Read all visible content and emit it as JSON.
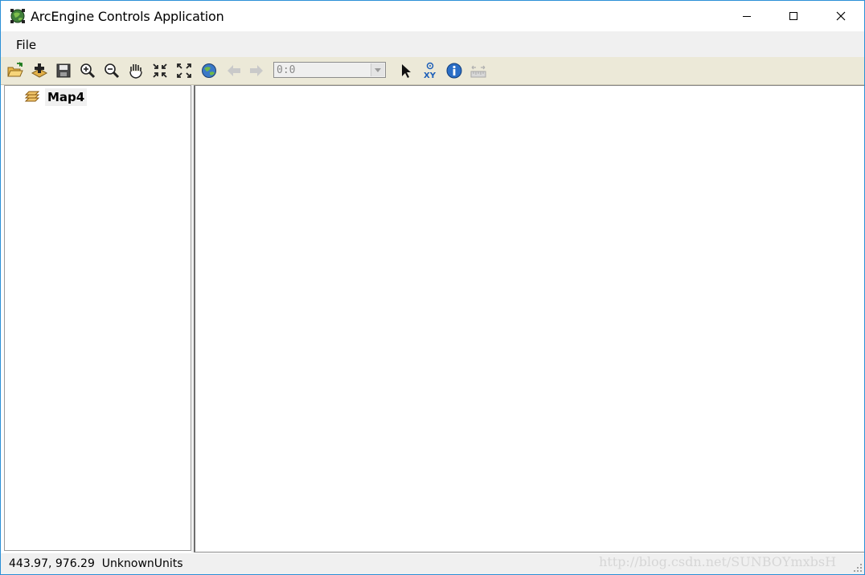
{
  "window": {
    "title": "ArcEngine Controls Application",
    "border_color": "#2b8fd6"
  },
  "menu": {
    "items": [
      "File"
    ]
  },
  "toolbar": {
    "icons": [
      "open-document-icon",
      "add-data-icon",
      "save-icon",
      "zoom-in-icon",
      "zoom-out-icon",
      "pan-icon",
      "fixed-zoom-in-icon",
      "fixed-zoom-out-icon",
      "full-extent-icon",
      "back-arrow-icon",
      "forward-arrow-icon",
      "select-arrow-icon",
      "go-to-xy-icon",
      "identify-icon",
      "measure-icon"
    ],
    "scale_value": "0:0"
  },
  "toc": {
    "map_name": "Map4"
  },
  "statusbar": {
    "coordinates": "443.97, 976.29",
    "units": "UnknownUnits"
  },
  "watermark": "http://blog.csdn.net/SUNBOYmxbsH"
}
